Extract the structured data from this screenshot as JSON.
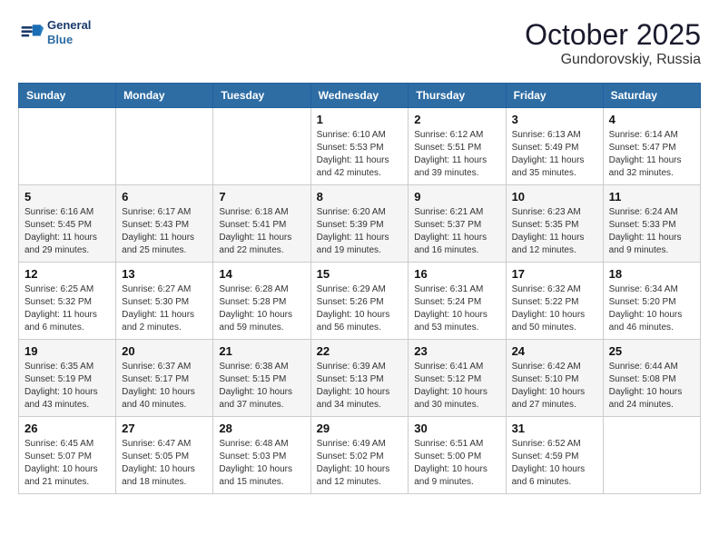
{
  "header": {
    "logo_line1": "General",
    "logo_line2": "Blue",
    "month_title": "October 2025",
    "location": "Gundorovskiy, Russia"
  },
  "weekdays": [
    "Sunday",
    "Monday",
    "Tuesday",
    "Wednesday",
    "Thursday",
    "Friday",
    "Saturday"
  ],
  "weeks": [
    [
      {
        "day": "",
        "info": ""
      },
      {
        "day": "",
        "info": ""
      },
      {
        "day": "",
        "info": ""
      },
      {
        "day": "1",
        "info": "Sunrise: 6:10 AM\nSunset: 5:53 PM\nDaylight: 11 hours\nand 42 minutes."
      },
      {
        "day": "2",
        "info": "Sunrise: 6:12 AM\nSunset: 5:51 PM\nDaylight: 11 hours\nand 39 minutes."
      },
      {
        "day": "3",
        "info": "Sunrise: 6:13 AM\nSunset: 5:49 PM\nDaylight: 11 hours\nand 35 minutes."
      },
      {
        "day": "4",
        "info": "Sunrise: 6:14 AM\nSunset: 5:47 PM\nDaylight: 11 hours\nand 32 minutes."
      }
    ],
    [
      {
        "day": "5",
        "info": "Sunrise: 6:16 AM\nSunset: 5:45 PM\nDaylight: 11 hours\nand 29 minutes."
      },
      {
        "day": "6",
        "info": "Sunrise: 6:17 AM\nSunset: 5:43 PM\nDaylight: 11 hours\nand 25 minutes."
      },
      {
        "day": "7",
        "info": "Sunrise: 6:18 AM\nSunset: 5:41 PM\nDaylight: 11 hours\nand 22 minutes."
      },
      {
        "day": "8",
        "info": "Sunrise: 6:20 AM\nSunset: 5:39 PM\nDaylight: 11 hours\nand 19 minutes."
      },
      {
        "day": "9",
        "info": "Sunrise: 6:21 AM\nSunset: 5:37 PM\nDaylight: 11 hours\nand 16 minutes."
      },
      {
        "day": "10",
        "info": "Sunrise: 6:23 AM\nSunset: 5:35 PM\nDaylight: 11 hours\nand 12 minutes."
      },
      {
        "day": "11",
        "info": "Sunrise: 6:24 AM\nSunset: 5:33 PM\nDaylight: 11 hours\nand 9 minutes."
      }
    ],
    [
      {
        "day": "12",
        "info": "Sunrise: 6:25 AM\nSunset: 5:32 PM\nDaylight: 11 hours\nand 6 minutes."
      },
      {
        "day": "13",
        "info": "Sunrise: 6:27 AM\nSunset: 5:30 PM\nDaylight: 11 hours\nand 2 minutes."
      },
      {
        "day": "14",
        "info": "Sunrise: 6:28 AM\nSunset: 5:28 PM\nDaylight: 10 hours\nand 59 minutes."
      },
      {
        "day": "15",
        "info": "Sunrise: 6:29 AM\nSunset: 5:26 PM\nDaylight: 10 hours\nand 56 minutes."
      },
      {
        "day": "16",
        "info": "Sunrise: 6:31 AM\nSunset: 5:24 PM\nDaylight: 10 hours\nand 53 minutes."
      },
      {
        "day": "17",
        "info": "Sunrise: 6:32 AM\nSunset: 5:22 PM\nDaylight: 10 hours\nand 50 minutes."
      },
      {
        "day": "18",
        "info": "Sunrise: 6:34 AM\nSunset: 5:20 PM\nDaylight: 10 hours\nand 46 minutes."
      }
    ],
    [
      {
        "day": "19",
        "info": "Sunrise: 6:35 AM\nSunset: 5:19 PM\nDaylight: 10 hours\nand 43 minutes."
      },
      {
        "day": "20",
        "info": "Sunrise: 6:37 AM\nSunset: 5:17 PM\nDaylight: 10 hours\nand 40 minutes."
      },
      {
        "day": "21",
        "info": "Sunrise: 6:38 AM\nSunset: 5:15 PM\nDaylight: 10 hours\nand 37 minutes."
      },
      {
        "day": "22",
        "info": "Sunrise: 6:39 AM\nSunset: 5:13 PM\nDaylight: 10 hours\nand 34 minutes."
      },
      {
        "day": "23",
        "info": "Sunrise: 6:41 AM\nSunset: 5:12 PM\nDaylight: 10 hours\nand 30 minutes."
      },
      {
        "day": "24",
        "info": "Sunrise: 6:42 AM\nSunset: 5:10 PM\nDaylight: 10 hours\nand 27 minutes."
      },
      {
        "day": "25",
        "info": "Sunrise: 6:44 AM\nSunset: 5:08 PM\nDaylight: 10 hours\nand 24 minutes."
      }
    ],
    [
      {
        "day": "26",
        "info": "Sunrise: 6:45 AM\nSunset: 5:07 PM\nDaylight: 10 hours\nand 21 minutes."
      },
      {
        "day": "27",
        "info": "Sunrise: 6:47 AM\nSunset: 5:05 PM\nDaylight: 10 hours\nand 18 minutes."
      },
      {
        "day": "28",
        "info": "Sunrise: 6:48 AM\nSunset: 5:03 PM\nDaylight: 10 hours\nand 15 minutes."
      },
      {
        "day": "29",
        "info": "Sunrise: 6:49 AM\nSunset: 5:02 PM\nDaylight: 10 hours\nand 12 minutes."
      },
      {
        "day": "30",
        "info": "Sunrise: 6:51 AM\nSunset: 5:00 PM\nDaylight: 10 hours\nand 9 minutes."
      },
      {
        "day": "31",
        "info": "Sunrise: 6:52 AM\nSunset: 4:59 PM\nDaylight: 10 hours\nand 6 minutes."
      },
      {
        "day": "",
        "info": ""
      }
    ]
  ]
}
